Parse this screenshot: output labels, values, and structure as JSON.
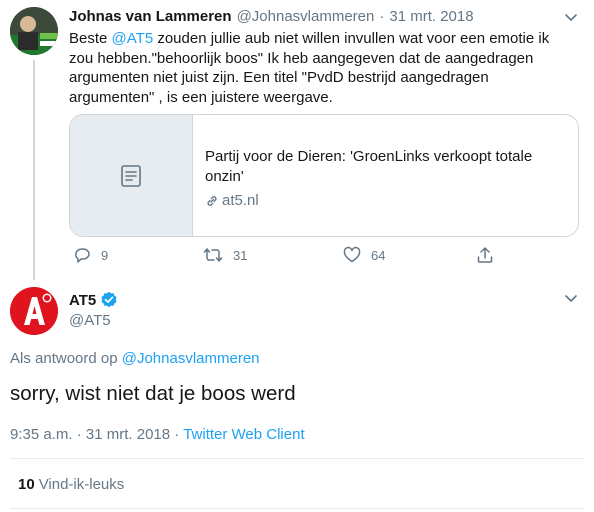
{
  "tweet_parent": {
    "name": "Johnas van Lammeren",
    "handle": "@Johnasvlammeren",
    "separator": "·",
    "date": "31 mrt. 2018",
    "text_before": "Beste ",
    "mention": "@AT5",
    "text_after": "  zouden jullie aub niet willen invullen wat voor een emotie ik zou hebben.\"behoorlijk boos\"  Ik heb aangegeven dat de aangedragen argumenten niet juist zijn. Een titel \"PvdD bestrijd aangedragen argumenten\" , is een juistere weergave.",
    "card": {
      "title": "Partij voor de Dieren: 'GroenLinks verkoopt totale onzin'",
      "url": "at5.nl",
      "thumb_icon": "document-icon"
    },
    "actions": {
      "replies": "9",
      "retweets": "31",
      "likes": "64"
    }
  },
  "tweet_main": {
    "name": "AT5",
    "handle": "@AT5",
    "verified": true,
    "reply_prefix": "Als antwoord op ",
    "reply_to": "@Johnasvlammeren",
    "text": "sorry, wist niet dat je boos werd",
    "time": "9:35 a.m.",
    "date": "31 mrt. 2018",
    "separator": "·",
    "client": "Twitter Web Client",
    "like_count": "10",
    "like_label": "Vind-ik-leuks"
  },
  "colors": {
    "accent": "#1da1f2",
    "muted": "#657786",
    "text": "#14171a",
    "at5_red": "#e0141e"
  }
}
